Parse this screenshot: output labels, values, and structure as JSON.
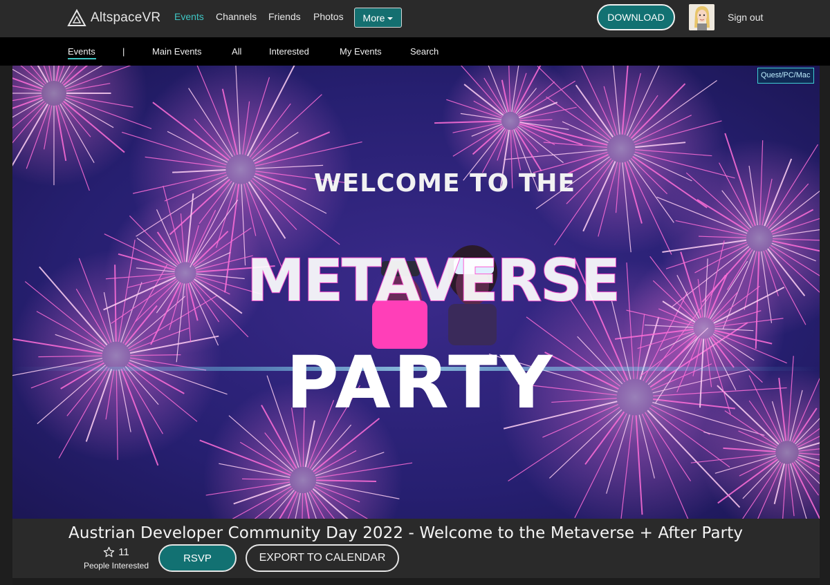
{
  "brand": {
    "name": "AltspaceVR"
  },
  "topnav": {
    "items": [
      {
        "label": "Events",
        "active": true
      },
      {
        "label": "Channels",
        "active": false
      },
      {
        "label": "Friends",
        "active": false
      },
      {
        "label": "Photos",
        "active": false
      }
    ],
    "more_label": "More",
    "download_label": "DOWNLOAD",
    "signout_label": "Sign out"
  },
  "subnav": {
    "items": [
      {
        "label": "Events",
        "active": true
      },
      {
        "label": "|"
      },
      {
        "label": "Main Events"
      },
      {
        "label": "All"
      },
      {
        "label": "Interested"
      },
      {
        "label": "My Events"
      },
      {
        "label": "Search"
      }
    ]
  },
  "hero": {
    "platform_badge": "Quest/PC/Mac",
    "headline_top": "WELCOME TO THE",
    "headline_mid": "METAVERSE",
    "headline_bottom": "PARTY"
  },
  "event": {
    "title": "Austrian Developer Community Day 2022 - Welcome to the Metaverse + After Party",
    "interested_count": "11",
    "interested_label": "People Interested",
    "rsvp_label": "RSVP",
    "export_label": "EXPORT TO CALENDAR"
  },
  "colors": {
    "accent": "#3fc6c4",
    "button_teal": "#127172",
    "nav_bg": "#2a2a2a",
    "subnav_bg": "#000000",
    "firework_pink": "#ff6fd8",
    "hero_navy": "#241e6a"
  },
  "icons": {
    "logo": "altspace-triangle-icon",
    "interested": "star-outline-icon",
    "more": "caret-down-icon"
  }
}
